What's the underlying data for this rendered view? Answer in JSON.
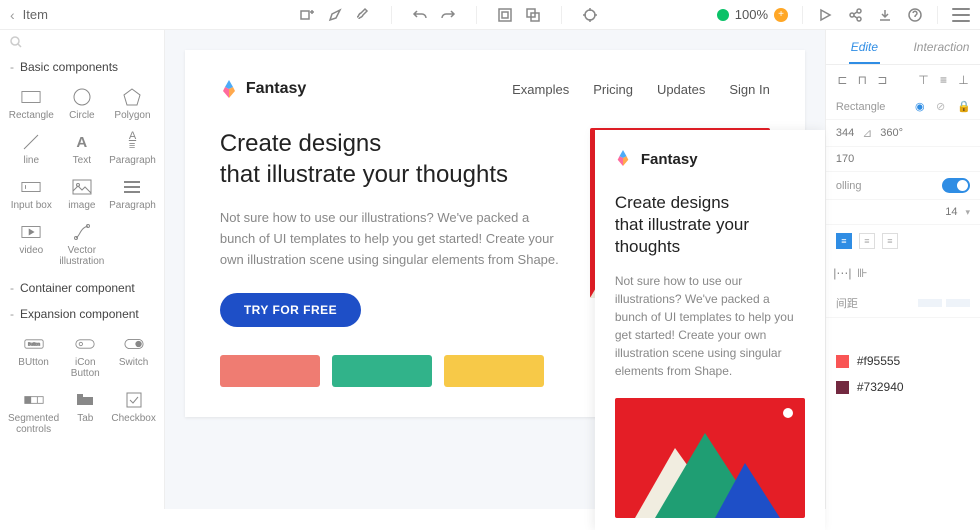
{
  "header": {
    "back_label": "Item",
    "zoom": "100%"
  },
  "sidebar": {
    "section_basic": "Basic components",
    "section_container": "Container component",
    "section_expansion": "Expansion component",
    "basic": [
      {
        "label": "Rectangle"
      },
      {
        "label": "Circle"
      },
      {
        "label": "Polygon"
      },
      {
        "label": "line"
      },
      {
        "label": "Text"
      },
      {
        "label": "Paragraph"
      },
      {
        "label": "Input box"
      },
      {
        "label": "image"
      },
      {
        "label": "Paragraph"
      },
      {
        "label": "video"
      },
      {
        "label": "Vector illustration"
      }
    ],
    "expansion": [
      {
        "label": "BUtton"
      },
      {
        "label": "iCon Button"
      },
      {
        "label": "Switch"
      },
      {
        "label": "Segmented controls"
      },
      {
        "label": "Tab"
      },
      {
        "label": "Checkbox"
      }
    ]
  },
  "artboard": {
    "brand": "Fantasy",
    "nav": [
      "Examples",
      "Pricing",
      "Updates",
      "Sign In"
    ],
    "hero_title_l1": "Create designs",
    "hero_title_l2": "that illustrate your thoughts",
    "hero_desc": "Not sure how to use our illustrations? We've packed a bunch of UI templates to help you get started! Create your own illustration scene using singular elements from Shape.",
    "cta": "TRY FOR FREE",
    "swatches": [
      "#ef7c72",
      "#31b38a",
      "#f7c948"
    ]
  },
  "preview": {
    "brand": "Fantasy",
    "title_l1": "Create designs",
    "title_l2": "that illustrate your thoughts",
    "desc": "Not sure how to use our illustrations? We've packed a bunch of UI templates to help you get started! Create your own illustration scene using singular elements from Shape."
  },
  "inspector": {
    "tab_edit": "Edite",
    "tab_interaction": "Interaction",
    "element_type": "Rectangle",
    "width": "344",
    "rotation": "360°",
    "height": "170",
    "scrolling_label": "olling",
    "font_size": "14",
    "spacing_label": "间距",
    "colors": [
      {
        "hex": "#f95555",
        "val": "#f95555"
      },
      {
        "hex": "#732940",
        "val": "#732940"
      }
    ]
  }
}
